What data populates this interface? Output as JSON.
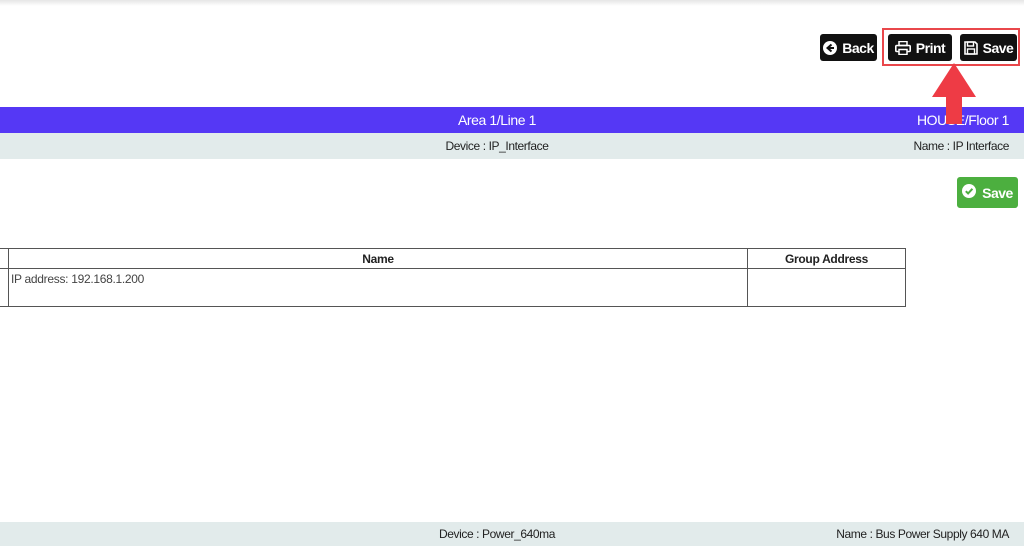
{
  "toolbar": {
    "back_label": "Back",
    "print_label": "Print",
    "save_label": "Save"
  },
  "location_bar": {
    "area": "Area 1/Line 1",
    "floor": "HOUSE/Floor 1"
  },
  "device_1": {
    "device": "Device : IP_Interface",
    "name": "Name : IP Interface"
  },
  "save_button": {
    "label": "Save"
  },
  "table": {
    "headers": [
      "Name",
      "Group Address"
    ],
    "rows": [
      {
        "name": "IP address: 192.168.1.200",
        "group_address": ""
      }
    ]
  },
  "device_2": {
    "device": "Device : Power_640ma",
    "name": "Name : Bus Power Supply 640 MA"
  },
  "colors": {
    "purple_bar": "#5538f5",
    "grey_bar": "#e2ebeb",
    "green_button": "#4caf3f",
    "highlight_red": "#ee3b45"
  }
}
